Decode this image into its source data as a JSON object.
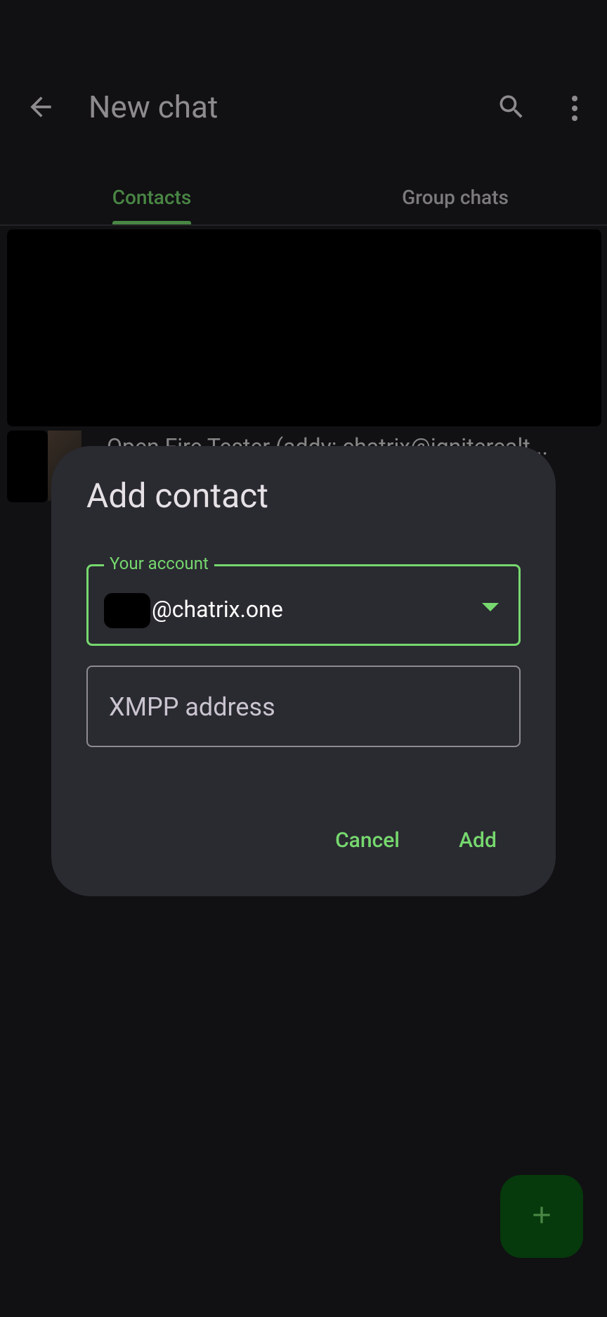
{
  "appbar": {
    "title": "New chat"
  },
  "tabs": [
    {
      "label": "Contacts"
    },
    {
      "label": "Group chats"
    }
  ],
  "contact_list": [
    {
      "name": "Open Fire Tester (addy: chatrix@igniterealt..."
    }
  ],
  "dialog": {
    "title": "Add contact",
    "account_field": {
      "label": "Your account",
      "value": "@chatrix.one"
    },
    "xmpp_field": {
      "placeholder": "XMPP address",
      "value": ""
    },
    "cancel_label": "Cancel",
    "add_label": "Add"
  },
  "icons": {
    "back": "arrow-back-icon",
    "search": "search-icon",
    "more": "more-vert-icon",
    "dropdown": "arrow-drop-down-icon",
    "fab": "plus-icon"
  },
  "colors": {
    "accent": "#76d86e",
    "fab_bg": "#0a5d14",
    "dialog_bg": "#2a2a31",
    "app_bg": "#1c1b1f"
  }
}
